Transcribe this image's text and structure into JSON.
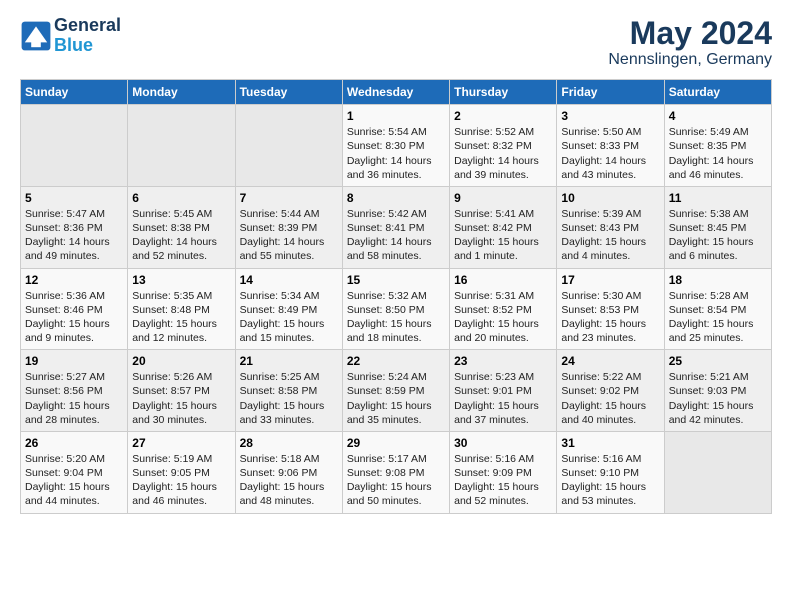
{
  "header": {
    "logo_line1": "General",
    "logo_line2": "Blue",
    "title": "May 2024",
    "subtitle": "Nennslingen, Germany"
  },
  "days_of_week": [
    "Sunday",
    "Monday",
    "Tuesday",
    "Wednesday",
    "Thursday",
    "Friday",
    "Saturday"
  ],
  "weeks": [
    [
      {
        "day": "",
        "empty": true
      },
      {
        "day": "",
        "empty": true
      },
      {
        "day": "",
        "empty": true
      },
      {
        "day": "1",
        "sunrise": "Sunrise: 5:54 AM",
        "sunset": "Sunset: 8:30 PM",
        "daylight": "Daylight: 14 hours and 36 minutes."
      },
      {
        "day": "2",
        "sunrise": "Sunrise: 5:52 AM",
        "sunset": "Sunset: 8:32 PM",
        "daylight": "Daylight: 14 hours and 39 minutes."
      },
      {
        "day": "3",
        "sunrise": "Sunrise: 5:50 AM",
        "sunset": "Sunset: 8:33 PM",
        "daylight": "Daylight: 14 hours and 43 minutes."
      },
      {
        "day": "4",
        "sunrise": "Sunrise: 5:49 AM",
        "sunset": "Sunset: 8:35 PM",
        "daylight": "Daylight: 14 hours and 46 minutes."
      }
    ],
    [
      {
        "day": "5",
        "sunrise": "Sunrise: 5:47 AM",
        "sunset": "Sunset: 8:36 PM",
        "daylight": "Daylight: 14 hours and 49 minutes."
      },
      {
        "day": "6",
        "sunrise": "Sunrise: 5:45 AM",
        "sunset": "Sunset: 8:38 PM",
        "daylight": "Daylight: 14 hours and 52 minutes."
      },
      {
        "day": "7",
        "sunrise": "Sunrise: 5:44 AM",
        "sunset": "Sunset: 8:39 PM",
        "daylight": "Daylight: 14 hours and 55 minutes."
      },
      {
        "day": "8",
        "sunrise": "Sunrise: 5:42 AM",
        "sunset": "Sunset: 8:41 PM",
        "daylight": "Daylight: 14 hours and 58 minutes."
      },
      {
        "day": "9",
        "sunrise": "Sunrise: 5:41 AM",
        "sunset": "Sunset: 8:42 PM",
        "daylight": "Daylight: 15 hours and 1 minute."
      },
      {
        "day": "10",
        "sunrise": "Sunrise: 5:39 AM",
        "sunset": "Sunset: 8:43 PM",
        "daylight": "Daylight: 15 hours and 4 minutes."
      },
      {
        "day": "11",
        "sunrise": "Sunrise: 5:38 AM",
        "sunset": "Sunset: 8:45 PM",
        "daylight": "Daylight: 15 hours and 6 minutes."
      }
    ],
    [
      {
        "day": "12",
        "sunrise": "Sunrise: 5:36 AM",
        "sunset": "Sunset: 8:46 PM",
        "daylight": "Daylight: 15 hours and 9 minutes."
      },
      {
        "day": "13",
        "sunrise": "Sunrise: 5:35 AM",
        "sunset": "Sunset: 8:48 PM",
        "daylight": "Daylight: 15 hours and 12 minutes."
      },
      {
        "day": "14",
        "sunrise": "Sunrise: 5:34 AM",
        "sunset": "Sunset: 8:49 PM",
        "daylight": "Daylight: 15 hours and 15 minutes."
      },
      {
        "day": "15",
        "sunrise": "Sunrise: 5:32 AM",
        "sunset": "Sunset: 8:50 PM",
        "daylight": "Daylight: 15 hours and 18 minutes."
      },
      {
        "day": "16",
        "sunrise": "Sunrise: 5:31 AM",
        "sunset": "Sunset: 8:52 PM",
        "daylight": "Daylight: 15 hours and 20 minutes."
      },
      {
        "day": "17",
        "sunrise": "Sunrise: 5:30 AM",
        "sunset": "Sunset: 8:53 PM",
        "daylight": "Daylight: 15 hours and 23 minutes."
      },
      {
        "day": "18",
        "sunrise": "Sunrise: 5:28 AM",
        "sunset": "Sunset: 8:54 PM",
        "daylight": "Daylight: 15 hours and 25 minutes."
      }
    ],
    [
      {
        "day": "19",
        "sunrise": "Sunrise: 5:27 AM",
        "sunset": "Sunset: 8:56 PM",
        "daylight": "Daylight: 15 hours and 28 minutes."
      },
      {
        "day": "20",
        "sunrise": "Sunrise: 5:26 AM",
        "sunset": "Sunset: 8:57 PM",
        "daylight": "Daylight: 15 hours and 30 minutes."
      },
      {
        "day": "21",
        "sunrise": "Sunrise: 5:25 AM",
        "sunset": "Sunset: 8:58 PM",
        "daylight": "Daylight: 15 hours and 33 minutes."
      },
      {
        "day": "22",
        "sunrise": "Sunrise: 5:24 AM",
        "sunset": "Sunset: 8:59 PM",
        "daylight": "Daylight: 15 hours and 35 minutes."
      },
      {
        "day": "23",
        "sunrise": "Sunrise: 5:23 AM",
        "sunset": "Sunset: 9:01 PM",
        "daylight": "Daylight: 15 hours and 37 minutes."
      },
      {
        "day": "24",
        "sunrise": "Sunrise: 5:22 AM",
        "sunset": "Sunset: 9:02 PM",
        "daylight": "Daylight: 15 hours and 40 minutes."
      },
      {
        "day": "25",
        "sunrise": "Sunrise: 5:21 AM",
        "sunset": "Sunset: 9:03 PM",
        "daylight": "Daylight: 15 hours and 42 minutes."
      }
    ],
    [
      {
        "day": "26",
        "sunrise": "Sunrise: 5:20 AM",
        "sunset": "Sunset: 9:04 PM",
        "daylight": "Daylight: 15 hours and 44 minutes."
      },
      {
        "day": "27",
        "sunrise": "Sunrise: 5:19 AM",
        "sunset": "Sunset: 9:05 PM",
        "daylight": "Daylight: 15 hours and 46 minutes."
      },
      {
        "day": "28",
        "sunrise": "Sunrise: 5:18 AM",
        "sunset": "Sunset: 9:06 PM",
        "daylight": "Daylight: 15 hours and 48 minutes."
      },
      {
        "day": "29",
        "sunrise": "Sunrise: 5:17 AM",
        "sunset": "Sunset: 9:08 PM",
        "daylight": "Daylight: 15 hours and 50 minutes."
      },
      {
        "day": "30",
        "sunrise": "Sunrise: 5:16 AM",
        "sunset": "Sunset: 9:09 PM",
        "daylight": "Daylight: 15 hours and 52 minutes."
      },
      {
        "day": "31",
        "sunrise": "Sunrise: 5:16 AM",
        "sunset": "Sunset: 9:10 PM",
        "daylight": "Daylight: 15 hours and 53 minutes."
      },
      {
        "day": "",
        "empty": true
      }
    ]
  ]
}
